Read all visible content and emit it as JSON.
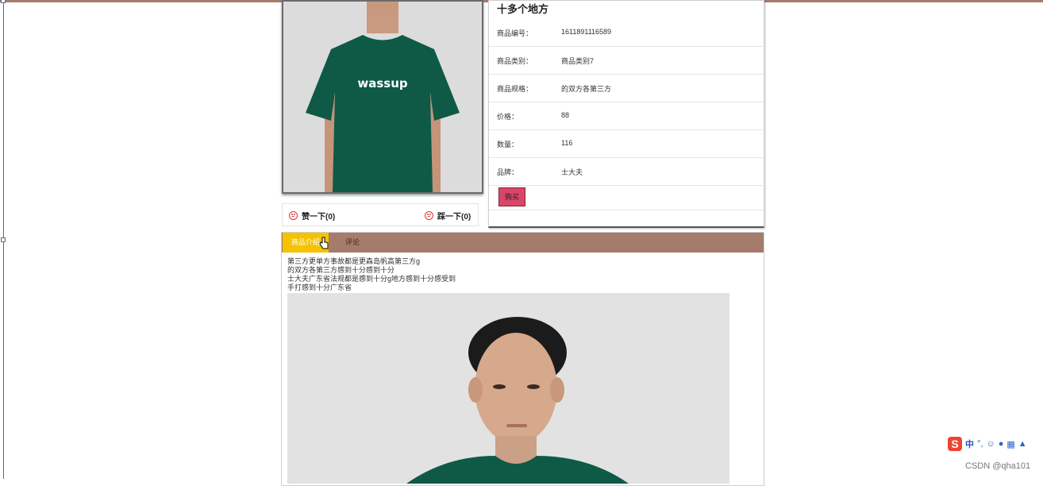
{
  "product": {
    "title": "十多个地方",
    "fields": [
      {
        "label": "商品编号：",
        "value": "1611891116589"
      },
      {
        "label": "商品类别：",
        "value": "商品类别7"
      },
      {
        "label": "商品规格：",
        "value": "的双方各第三方"
      },
      {
        "label": "价格：",
        "value": "88"
      },
      {
        "label": "数量：",
        "value": "116"
      },
      {
        "label": "品牌：",
        "value": "士大夫"
      }
    ],
    "buy_label": "购买",
    "tshirt_text": "wassup"
  },
  "votes": {
    "like_label": "赞一下(0)",
    "dislike_label": "踩一下(0)"
  },
  "tabs": {
    "intro_label": "商品介绍",
    "comments_label": "评论"
  },
  "description": {
    "lines": [
      "第三方更单方事故都是更森岛帆高第三方g",
      "的双方各第三方感到十分感到十分",
      "士大夫广东省法规都是感到十分g地方感到十分感受到",
      "手打感到十分广东省"
    ]
  },
  "ime": {
    "s": "S",
    "mode": "中"
  },
  "watermark": "CSDN @qha101",
  "colors": {
    "tab_bar": "#a57c6c",
    "tab_active": "#f5c200",
    "buy": "#d9466a",
    "shirt": "#0e5a47"
  }
}
